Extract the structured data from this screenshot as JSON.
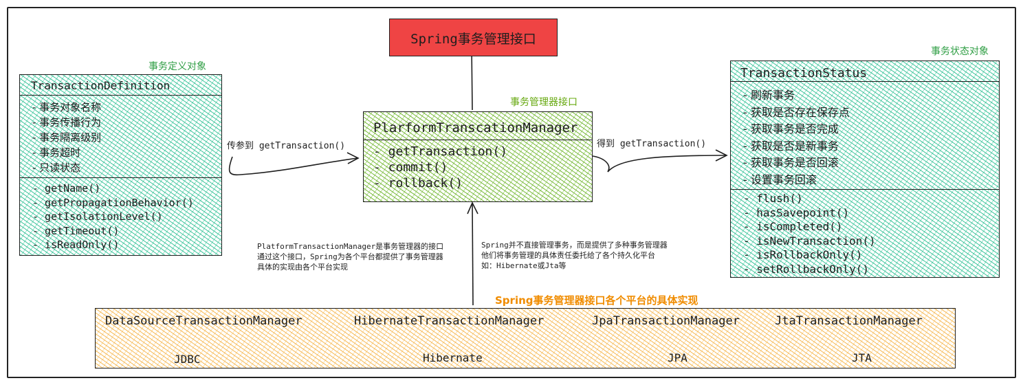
{
  "header": {
    "title": "Spring事务管理接口"
  },
  "definition": {
    "section_label": "事务定义对象",
    "title": "TransactionDefinition",
    "attributes": [
      "- 事务对象名称",
      "- 事务传播行为",
      "- 事务隔离级别",
      "- 事务超时",
      "- 只读状态"
    ],
    "methods": [
      "- getName()",
      "- getPropagationBehavior()",
      "- getIsolationLevel()",
      "- getTimeout()",
      "- isReadOnly()"
    ]
  },
  "manager": {
    "section_label": "事务管理器接口",
    "title": "PlarformTranscationManager",
    "methods": [
      "- getTransaction()",
      "- commit()",
      "- rollback()"
    ]
  },
  "status": {
    "section_label": "事务状态对象",
    "title": "TransactionStatus",
    "attributes": [
      "- 刷新事务",
      "- 获取是否存在保存点",
      "- 获取事务是否完成",
      "- 获取是否是新事务",
      "- 获取事务是否回滚",
      "- 设置事务回滚"
    ],
    "methods": [
      "- flush()",
      "- hasSavepoint()",
      "- isCompleted()",
      "- isNewTransaction()",
      "- isRollbackOnly()",
      "- setRollbackOnly()"
    ]
  },
  "arrows": {
    "left_label": "传参到 getTransaction()",
    "right_label": "得到 getTransaction()"
  },
  "notes": {
    "left": [
      "PlatformTransactionManager是事务管理器的接口",
      "通过这个接口，Spring为各个平台都提供了事务管理器",
      "具体的实现由各个平台实现"
    ],
    "right": [
      "Spring并不直接管理事务，而是提供了多种事务管理器",
      "他们将事务管理的具体责任委托给了各个持久化平台",
      "如：Hibernate或Jta等"
    ]
  },
  "implementations": {
    "section_label": "Spring事务管理器接口各个平台的具体实现",
    "items": [
      {
        "name": "DataSourceTransactionManager",
        "tech": "JDBC"
      },
      {
        "name": "HibernateTransactionManager",
        "tech": "Hibernate"
      },
      {
        "name": "JpaTransactionManager",
        "tech": "JPA"
      },
      {
        "name": "JtaTransactionManager",
        "tech": "JTA"
      }
    ]
  },
  "colors": {
    "red": "#ef4444",
    "teal": "#12b886",
    "green": "#82c91e",
    "yellow": "#f5af3c",
    "label_green": "#2f9e44",
    "label_lime": "#66a80f",
    "label_orange": "#f08c00"
  }
}
